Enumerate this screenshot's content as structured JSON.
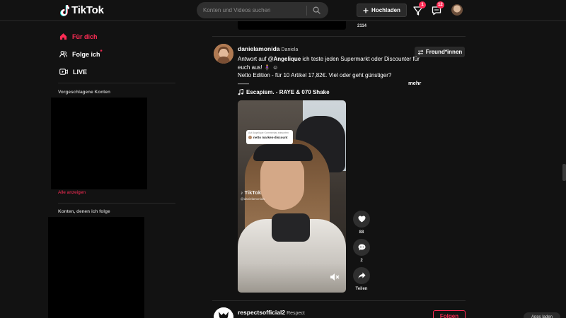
{
  "header": {
    "logo_text": "TikTok",
    "search_placeholder": "Konten und Videos suchen",
    "upload_label": "Hochladen",
    "inbox_badge": "1",
    "messages_badge": "12"
  },
  "sidebar": {
    "nav": [
      {
        "label": "Für dich",
        "icon": "home-icon",
        "active": true
      },
      {
        "label": "Folge ich",
        "icon": "following-icon",
        "active": false
      },
      {
        "label": "LIVE",
        "icon": "live-icon",
        "active": false
      }
    ],
    "suggested_title": "Vorgeschlagene Konten",
    "see_all": "Alle anzeigen",
    "following_title": "Konten, denen ich folge"
  },
  "feed": {
    "prev_count": "2114",
    "post": {
      "username": "danielamonida",
      "nickname": "Daniela",
      "follow_label": "Freund*innen",
      "caption_prefix": "Antwort auf",
      "caption_mention": "@Angelique",
      "caption_rest": "ich teste jeden Supermarkt oder Discounter für euch aus! 🧍‍♀️ ☺",
      "caption_line2": "Netto Edition - für 10 Artikel 17,82€. Viel oder geht günstiger?",
      "caption_line3": "——",
      "more_label": "mehr",
      "music": "Escapism. - RAYE & 070 Shake",
      "video_reply_title": "Auf Angelique Kommentar antworten",
      "video_reply_text": "netto marken-discount",
      "video_watermark": "TikTok",
      "video_watermark_user": "@danielamonida",
      "likes": "88",
      "comments": "2",
      "share_label": "Teilen"
    },
    "next_post": {
      "username": "respectsofficial2",
      "nickname": "Respect",
      "follow_label": "Folgen"
    }
  },
  "corner_label": "Apps laden",
  "colors": {
    "accent": "#fe2c55",
    "background": "#121212",
    "surface": "#2a2a2a"
  }
}
